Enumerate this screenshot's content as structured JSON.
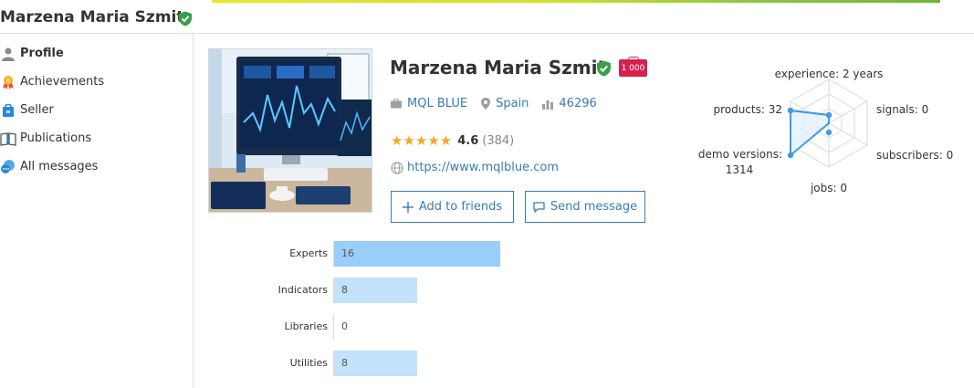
{
  "header": {
    "title": "Marzena Maria Szmit",
    "verified_icon": "shield-check-icon"
  },
  "sidebar": {
    "items": [
      {
        "label": "Profile",
        "icon": "user-icon",
        "active": true
      },
      {
        "label": "Achievements",
        "icon": "medal-icon",
        "active": false
      },
      {
        "label": "Seller",
        "icon": "shop-icon",
        "active": false
      },
      {
        "label": "Publications",
        "icon": "book-icon",
        "active": false
      },
      {
        "label": "All messages",
        "icon": "chat-icon",
        "active": false
      }
    ]
  },
  "profile": {
    "name": "Marzena Maria Szmit",
    "badge": "1 000",
    "company": "MQL BLUE",
    "country": "Spain",
    "rating_points": "46296",
    "rating": "4.6",
    "reviews": "(384)",
    "stars": 5,
    "website": "https://www.mqlblue.com",
    "add_friends_label": "Add to friends",
    "send_message_label": "Send message"
  },
  "radar": {
    "experience": "experience: 2 years",
    "signals": "signals: 0",
    "subscribers": "subscribers: 0",
    "jobs": "jobs: 0",
    "demo_line1": "demo versions:",
    "demo_line2": "1314",
    "products": "products: 32"
  },
  "chart_data": {
    "type": "bar",
    "orientation": "horizontal",
    "categories": [
      "Experts",
      "Indicators",
      "Libraries",
      "Utilities"
    ],
    "values": [
      16,
      8,
      0,
      8
    ],
    "xlim": [
      0,
      16
    ]
  },
  "colors": {
    "accent": "#3a7bb5",
    "bar_primary": "#99cdfa",
    "bar_secondary": "#c2e1fb",
    "verified": "#37a04a",
    "badge": "#d6214f",
    "star": "#f5a623"
  }
}
